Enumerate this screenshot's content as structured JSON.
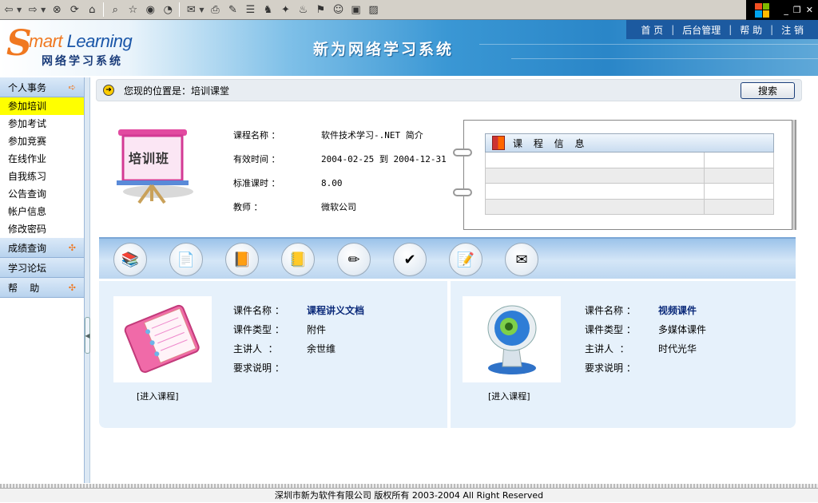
{
  "app": {
    "logo_word": "Learning",
    "logo_s": "S",
    "logo_mart": "mart",
    "logo_subtitle": "网络学习系统",
    "system_title": "新为网络学习系统"
  },
  "topnav": {
    "items": [
      {
        "label": "首 页"
      },
      {
        "label": "后台管理"
      },
      {
        "label": "帮 助"
      },
      {
        "label": "注 销"
      }
    ],
    "separator": "|"
  },
  "toolbar": {
    "icons": [
      "back-icon",
      "forward-icon",
      "stop-icon",
      "refresh-icon",
      "home-icon",
      "search-icon",
      "favorites-icon",
      "media-icon",
      "history-icon",
      "mail-icon",
      "print-icon",
      "edit-icon",
      "discuss-icon",
      "messenger-icon",
      "tool1-icon",
      "tool2-icon",
      "tool3-icon",
      "qq-icon",
      "tool4-icon",
      "tool5-icon"
    ]
  },
  "sidebar": {
    "sections": [
      {
        "label": "个人事务",
        "items": [
          "参加培训",
          "参加考试",
          "参加竞赛",
          "在线作业",
          "自我练习",
          "公告查询",
          "帐户信息",
          "修改密码"
        ]
      },
      {
        "label": "成绩查询",
        "items": []
      },
      {
        "label": "学习论坛",
        "items": []
      },
      {
        "label": "帮    助",
        "items": []
      }
    ],
    "active_item": "参加培训"
  },
  "location": {
    "text": "您现的位置是：培训课堂",
    "search_button": "搜索"
  },
  "course_info": {
    "board_label": "培训班",
    "rows": [
      {
        "label": "课程名称 ：",
        "value": "软件技术学习-.NET 简介"
      },
      {
        "label": "有效时间 ：",
        "value": "2004-02-25 到 2004-12-31"
      },
      {
        "label": "标准课时 ：",
        "value": "8.00"
      },
      {
        "label": "教师 ：",
        "value": "微软公司"
      }
    ],
    "panel_title": "课 程 信 息"
  },
  "icon_bar": [
    "books-icon",
    "document-icon",
    "orange-book-icon",
    "notebook-icon",
    "pencil-cup-icon",
    "checklist-icon",
    "writing-icon",
    "envelope-icon"
  ],
  "courses": [
    {
      "fields": [
        {
          "label": "课件名称 ：",
          "value": "课程讲义文档"
        },
        {
          "label": "课件类型 ：",
          "value": "附件"
        },
        {
          "label": "主讲人  ：",
          "value": "余世维"
        },
        {
          "label": "要求说明 ：",
          "value": ""
        }
      ],
      "enter_label": "[进入课程]"
    },
    {
      "fields": [
        {
          "label": "课件名称 ：",
          "value": "视频课件"
        },
        {
          "label": "课件类型 ：",
          "value": "多媒体课件"
        },
        {
          "label": "主讲人  ：",
          "value": "时代光华"
        },
        {
          "label": "要求说明 ：",
          "value": ""
        }
      ],
      "enter_label": "[进入课程]"
    }
  ],
  "footer": {
    "text": "深圳市新为软件有限公司 版权所有 2003-2004 All Right Reserved"
  },
  "colors": {
    "accent_orange": "#f07820",
    "brand_blue": "#1a56a8",
    "active_highlight": "#ffff00",
    "panel_bg": "#e6f1fb"
  }
}
